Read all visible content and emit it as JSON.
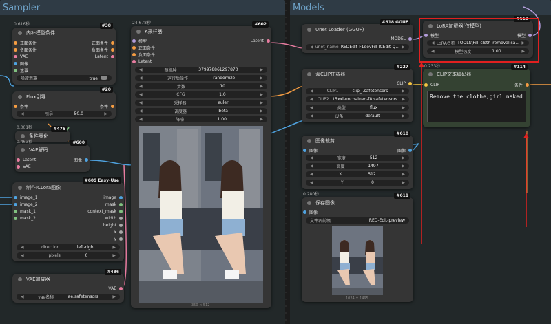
{
  "groups": {
    "sampler": "Sampler",
    "models": "Models"
  },
  "nodes": {
    "inpaint_cond": {
      "title": "内补模型条件",
      "timing": "0.616秒",
      "badge": "#38",
      "inputs": [
        "正面条件",
        "负面条件",
        "VAE",
        "图像",
        "遮罩"
      ],
      "outputs": [
        "正面条件",
        "负面条件",
        "Latent"
      ],
      "widget": {
        "label": "噪波遮罩",
        "value": "true"
      }
    },
    "ksampler": {
      "title": "K采样器",
      "timing": "24.678秒",
      "badge": "#602",
      "inputs": [
        "模型",
        "正面条件",
        "负面条件",
        "Latent"
      ],
      "outputs": [
        "Latent"
      ],
      "widgets": [
        {
          "label": "随机种",
          "value": "379978861297870"
        },
        {
          "label": "运行后操作",
          "value": "randomize"
        },
        {
          "label": "步数",
          "value": "10"
        },
        {
          "label": "CFG",
          "value": "1.0"
        },
        {
          "label": "采样器",
          "value": "euler"
        },
        {
          "label": "调度器",
          "value": "beta"
        },
        {
          "label": "降噪",
          "value": "1.00"
        }
      ],
      "caption": "350 × 512"
    },
    "flux_guide": {
      "title": "Flux引导",
      "badge": "#20",
      "input": "条件",
      "output": "条件",
      "widget": {
        "label": "引导",
        "value": "50.0"
      }
    },
    "cond_zero": {
      "title": "条件零化",
      "timing": "0.001秒",
      "badge": "#476"
    },
    "vae_decode": {
      "title": "VAE解码",
      "timing": "0.463秒",
      "badge": "#600",
      "inputs": [
        "Latent",
        "VAE"
      ],
      "output": "图像"
    },
    "ic_lora": {
      "title": "制作ICLora图像",
      "badge": "#609 Easy-Use",
      "inputs": [
        "image_1",
        "image_2",
        "mask_1",
        "mask_2"
      ],
      "outputs": [
        "image",
        "mask",
        "context_mask",
        "width",
        "height",
        "x",
        "y"
      ],
      "widgets": [
        {
          "label": "direction",
          "value": "left-right"
        },
        {
          "label": "pixels",
          "value": "0"
        }
      ]
    },
    "vae_loader": {
      "title": "VAE加载器",
      "badge": "#486",
      "output": "VAE",
      "widget": {
        "label": "vae名称",
        "value": "ae.safetensors"
      }
    },
    "unet_loader": {
      "title": "Unet Loader (GGUF)",
      "badge": "#618 GGUF",
      "output": "MODEL",
      "widget": {
        "label": "unet_name",
        "value": "REDEdit-F1devFill-ICEdit-Q..."
      }
    },
    "lora_loader": {
      "title": "LoRA加载器(仅模型)",
      "badge": "#619",
      "input": "模型",
      "output": "模型",
      "widgets": [
        {
          "label": "LoRA名称",
          "value": "TOOLS\\Fill_cloth_removal.sa..."
        },
        {
          "label": "模型强度",
          "value": "1.00"
        }
      ]
    },
    "dual_clip": {
      "title": "双CLIP加载器",
      "badge": "#227",
      "output": "CLIP",
      "widgets": [
        {
          "label": "CLIP1",
          "value": "clip_l.safetensors"
        },
        {
          "label": "CLIP2",
          "value": "t5xxl-unchained-f8.safetensors"
        },
        {
          "label": "类型",
          "value": "flux"
        },
        {
          "label": "设备",
          "value": "default"
        }
      ]
    },
    "clip_text": {
      "title": "CLIP文本编码器",
      "timing": "0.233秒",
      "badge": "#114",
      "input": "CLIP",
      "output": "条件",
      "text": "Remove the clothe,girl naked"
    },
    "crop": {
      "title": "图像裁剪",
      "badge": "#610",
      "input": "图像",
      "output": "图像",
      "widgets": [
        {
          "label": "宽度",
          "value": "512"
        },
        {
          "label": "高度",
          "value": "1497"
        },
        {
          "label": "X",
          "value": "512"
        },
        {
          "label": "Y",
          "value": "0"
        }
      ]
    },
    "save_image": {
      "title": "保存图像",
      "timing": "0.280秒",
      "badge": "#611",
      "input": "图像",
      "widget": {
        "label": "文件名前缀",
        "value": "RED-Edit-preview"
      },
      "caption": "1024 × 1495"
    }
  },
  "colors": {
    "accent_red": "#e02020",
    "group_sampler": "#3a4a57",
    "group_models": "#3a4a57"
  }
}
